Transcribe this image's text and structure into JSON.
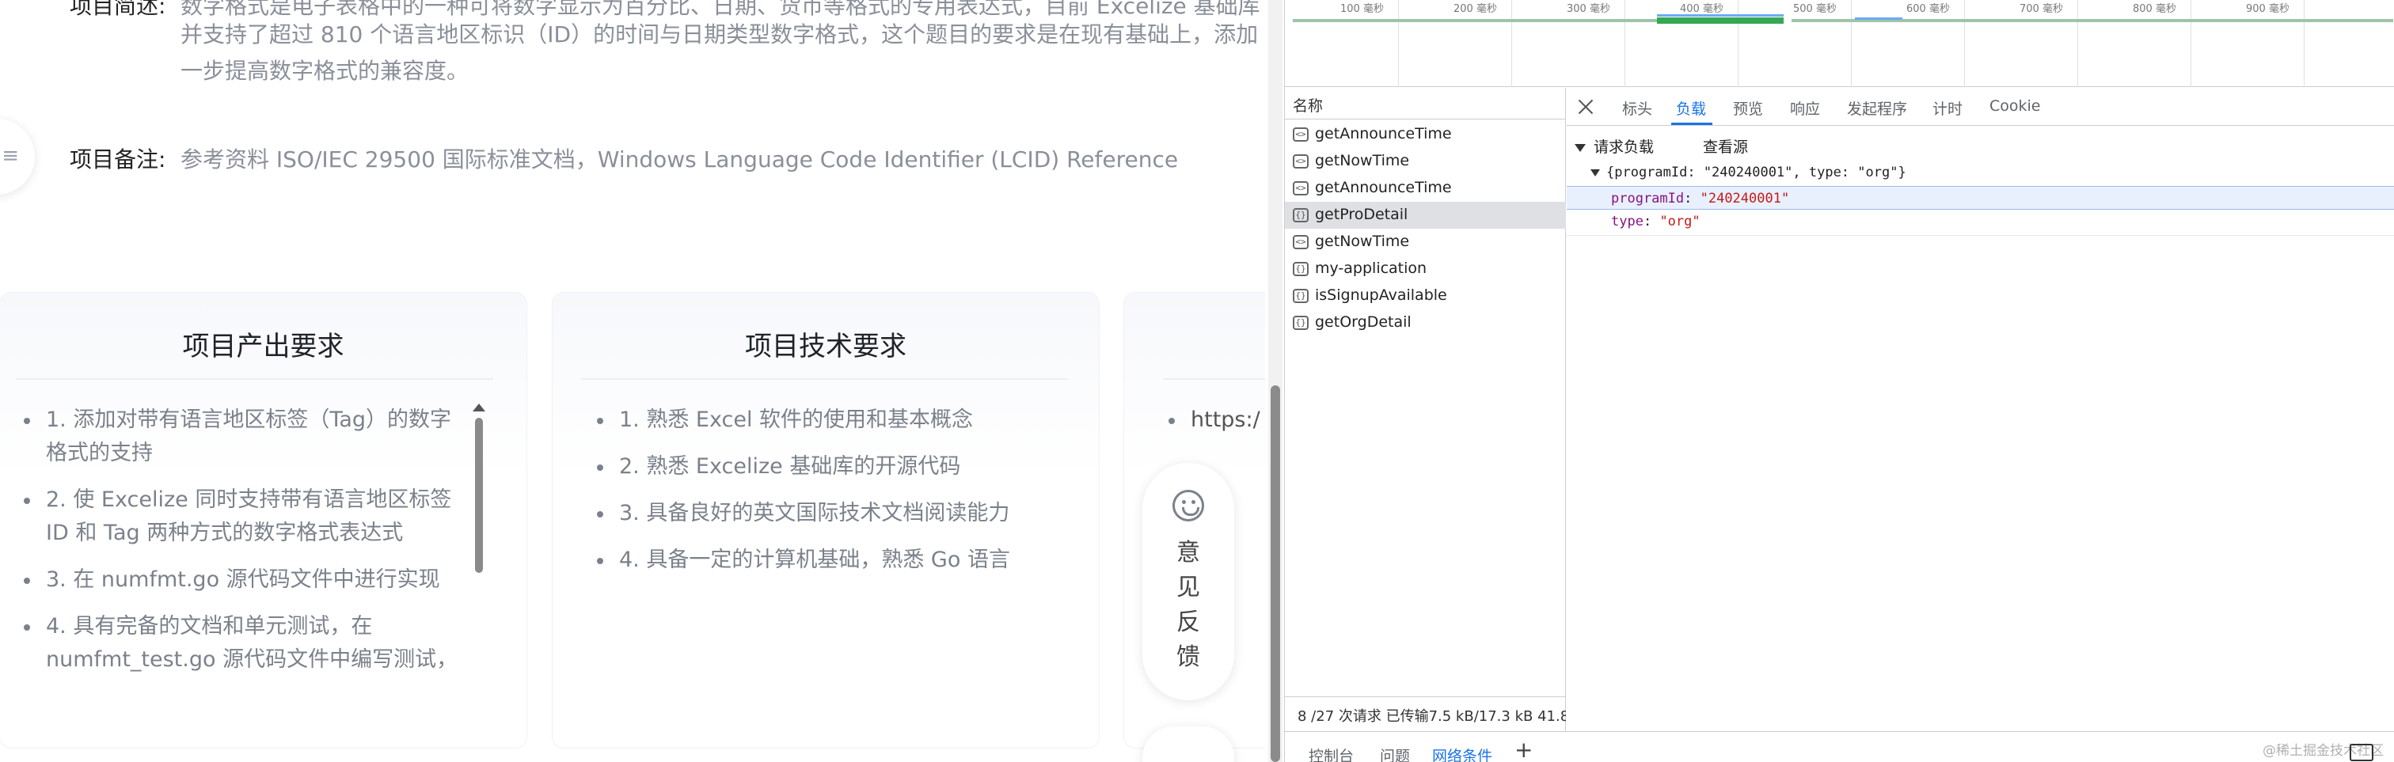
{
  "project": {
    "summary_label": "项目简述:",
    "summary_lines": [
      "数字格式是电子表格中的一种可将数字显示为百分比、日期、货币等格式的专用表达式，目前 Excelize 基础库",
      "并支持了超过 810 个语言地区标识（ID）的时间与日期类型数字格式，这个题目的要求是在现有基础上，添加",
      "一步提高数字格式的兼容度。"
    ],
    "notes_label": "项目备注:",
    "notes_value": "参考资料 ISO/IEC 29500 国际标准文档，Windows Language Code Identifier (LCID) Reference"
  },
  "cards": {
    "output": {
      "title": "项目产出要求",
      "items": [
        [
          "1. 添加对带有语言地区标签（Tag）的数字",
          "格式的支持"
        ],
        [
          "2. 使 Excelize 同时支持带有语言地区标签",
          "ID 和 Tag 两种方式的数字格式表达式"
        ],
        [
          "3. 在 numfmt.go 源代码文件中进行实现"
        ],
        [
          "4. 具有完备的文档和单元测试，在",
          "numfmt_test.go 源代码文件中编写测试，"
        ]
      ]
    },
    "tech": {
      "title": "项目技术要求",
      "items": [
        "1. 熟悉 Excel 软件的使用和基本概念",
        "2. 熟悉 Excelize 基础库的开源代码",
        "3. 具备良好的英文国际技术文档阅读能力",
        "4. 具备一定的计算机基础，熟悉 Go 语言"
      ]
    },
    "links": {
      "item": "https:/"
    }
  },
  "feedback": {
    "chars": [
      "意",
      "见",
      "反",
      "馈"
    ]
  },
  "devtools": {
    "overview_labels": [
      "100 毫秒",
      "200 毫秒",
      "300 毫秒",
      "400 毫秒",
      "500 毫秒",
      "600 毫秒",
      "700 毫秒",
      "800 毫秒",
      "900 毫秒"
    ],
    "names_header": "名称",
    "requests": [
      {
        "name": "getAnnounceTime",
        "icon": "xhr-icon"
      },
      {
        "name": "getNowTime",
        "icon": "xhr-icon"
      },
      {
        "name": "getAnnounceTime",
        "icon": "xhr-icon"
      },
      {
        "name": "getProDetail",
        "icon": "fetch-icon"
      },
      {
        "name": "getNowTime",
        "icon": "xhr-icon"
      },
      {
        "name": "my-application",
        "icon": "fetch-icon"
      },
      {
        "name": "isSignupAvailable",
        "icon": "fetch-icon"
      },
      {
        "name": "getOrgDetail",
        "icon": "fetch-icon"
      }
    ],
    "status": "8 /27 次请求  已传输7.5 kB/17.3 kB  41.8",
    "tabs": [
      "标头",
      "负载",
      "预览",
      "响应",
      "发起程序",
      "计时",
      "Cookie"
    ],
    "active_tab": "负载",
    "payload": {
      "section": "请求负载",
      "view_source": "查看源",
      "summary": "{programId: \"240240001\", type: \"org\"}",
      "fields": [
        {
          "key": "programId",
          "value": "\"240240001\""
        },
        {
          "key": "type",
          "value": "\"org\""
        }
      ]
    },
    "drawer_tabs": [
      "控制台",
      "问题",
      "网络条件"
    ],
    "active_drawer_tab": "网络条件",
    "colors": {
      "accent": "#1a73e8",
      "key": "#881280",
      "string": "#c41a16"
    }
  },
  "watermark": "@稀土掘金技术社区"
}
